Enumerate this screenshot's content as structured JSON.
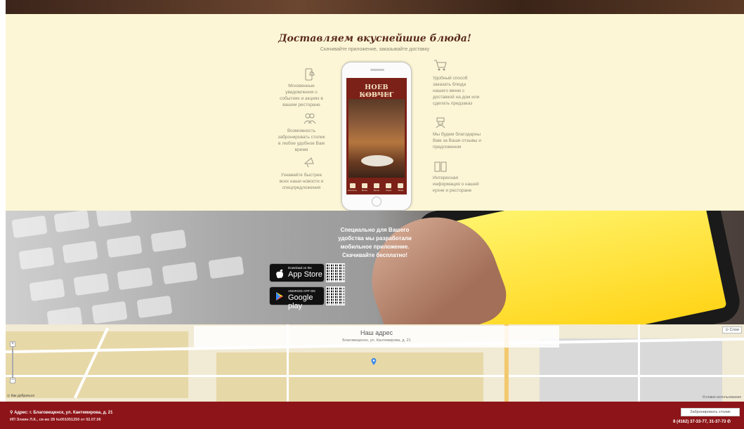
{
  "promo": {
    "title": "Доставляем вкуснейшие блюда!",
    "subtitle": "Скачивайте приложение, заказывайте доставку",
    "features_left": [
      {
        "icon": "phone-bell-icon",
        "text": "Мгновенные уведомления о событиях и акциях в вашем ресторане"
      },
      {
        "icon": "people-icon",
        "text": "Возможность забронировать столик в любое удобное Вам время"
      },
      {
        "icon": "megaphone-icon",
        "text": "Узнавайте быстрее всех наши новости и спецпредложения"
      }
    ],
    "features_right": [
      {
        "icon": "shopping-cart-icon",
        "text": "Удобный способ заказать блюда нашего меню с доставкой на дом или сделать предзаказ"
      },
      {
        "icon": "chef-icon",
        "text": "Мы будем благодарны Вам за Ваши отзывы и предложения"
      },
      {
        "icon": "book-icon",
        "text": "Интересная информация о нашей кухне и ресторане"
      }
    ],
    "app": {
      "name": "НОЕВ КОВЧЕГ",
      "subtitle": "армянская кухня",
      "nav": [
        "Контакты",
        "Меню",
        "Бронь",
        "Акции",
        "Инфо"
      ]
    }
  },
  "apps": {
    "text_lines": [
      "Специально для Вашего удобства мы разработали мобильное приложение.",
      "Скачивайте бесплатно!"
    ],
    "appstore": {
      "small": "Download on the",
      "big": "App Store"
    },
    "googleplay": {
      "small": "ANDROID APP ON",
      "big": "Google play"
    }
  },
  "map": {
    "title": "Наш адрес",
    "address": "Благовещенск, ул. Кантемирова, д. 21",
    "layers": "Слои",
    "route": "Как добраться",
    "terms": "Условия использования"
  },
  "footer": {
    "address": "Адрес: г. Благовещенск, ул. Кантемирова, д. 21",
    "ip": "ИП Элиян Л.К., св-во 28 №001051250 от 02.07.06",
    "reserve": "Забронировать столик",
    "phones": "8 (4162) 37-33-77, 31-37-73"
  },
  "colors": {
    "cream": "#fcf6d6",
    "footer": "#8d1418",
    "app_red": "#7b2118"
  }
}
